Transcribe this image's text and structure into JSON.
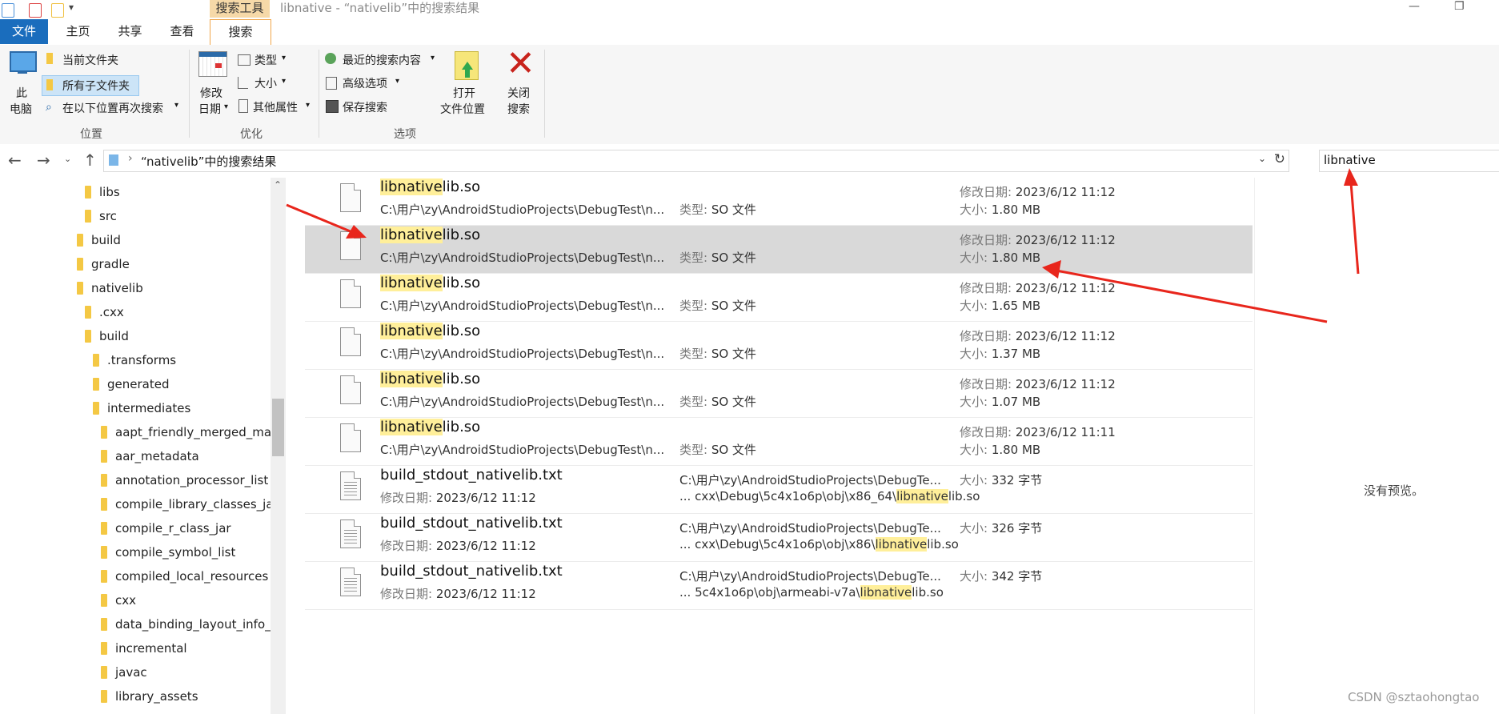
{
  "window": {
    "title": "libnative - “nativelib”中的搜索结果",
    "context_tab_header": "搜索工具"
  },
  "ribbon_tabs": [
    "文件",
    "主页",
    "共享",
    "查看",
    "搜索"
  ],
  "ribbon": {
    "this_pc_line1": "此",
    "this_pc_line2": "电脑",
    "current_folder": "当前文件夹",
    "all_subfolders": "所有子文件夹",
    "search_again_in": "在以下位置再次搜索",
    "group_location": "位置",
    "modified_line1": "修改",
    "modified_line2": "日期",
    "kind": "类型",
    "size": "大小",
    "other_properties": "其他属性",
    "group_refine": "优化",
    "recent_searches": "最近的搜索内容",
    "advanced_options": "高级选项",
    "save_search": "保存搜索",
    "open_location_line1": "打开",
    "open_location_line2": "文件位置",
    "close_search_line1": "关闭",
    "close_search_line2": "搜索",
    "group_options": "选项"
  },
  "address": {
    "path": "“nativelib”中的搜索结果",
    "search_value": "libnative"
  },
  "nav_tree": [
    {
      "label": "libs"
    },
    {
      "label": "src"
    },
    {
      "label": "build"
    },
    {
      "label": "gradle"
    },
    {
      "label": "nativelib"
    },
    {
      "label": ".cxx"
    },
    {
      "label": "build"
    },
    {
      "label": ".transforms"
    },
    {
      "label": "generated"
    },
    {
      "label": "intermediates"
    },
    {
      "label": "aapt_friendly_merged_ma"
    },
    {
      "label": "aar_metadata"
    },
    {
      "label": "annotation_processor_list"
    },
    {
      "label": "compile_library_classes_ja"
    },
    {
      "label": "compile_r_class_jar"
    },
    {
      "label": "compile_symbol_list"
    },
    {
      "label": "compiled_local_resources"
    },
    {
      "label": "cxx"
    },
    {
      "label": "data_binding_layout_info_"
    },
    {
      "label": "incremental"
    },
    {
      "label": "javac"
    },
    {
      "label": "library_assets"
    }
  ],
  "labels": {
    "modified": "修改日期: ",
    "size": "大小: ",
    "type": "类型: "
  },
  "results": [
    {
      "name_hl": "libnative",
      "name_rest": "lib.so",
      "path": "C:\\用户\\zy\\AndroidStudioProjects\\DebugTest\\n...",
      "type": "SO 文件",
      "date": "2023/6/12 11:12",
      "size": "1.80 MB"
    },
    {
      "name_hl": "libnative",
      "name_rest": "lib.so",
      "path": "C:\\用户\\zy\\AndroidStudioProjects\\DebugTest\\n...",
      "type": "SO 文件",
      "date": "2023/6/12 11:12",
      "size": "1.80 MB"
    },
    {
      "name_hl": "libnative",
      "name_rest": "lib.so",
      "path": "C:\\用户\\zy\\AndroidStudioProjects\\DebugTest\\n...",
      "type": "SO 文件",
      "date": "2023/6/12 11:12",
      "size": "1.65 MB"
    },
    {
      "name_hl": "libnative",
      "name_rest": "lib.so",
      "path": "C:\\用户\\zy\\AndroidStudioProjects\\DebugTest\\n...",
      "type": "SO 文件",
      "date": "2023/6/12 11:12",
      "size": "1.37 MB"
    },
    {
      "name_hl": "libnative",
      "name_rest": "lib.so",
      "path": "C:\\用户\\zy\\AndroidStudioProjects\\DebugTest\\n...",
      "type": "SO 文件",
      "date": "2023/6/12 11:12",
      "size": "1.07 MB"
    },
    {
      "name_hl": "libnative",
      "name_rest": "lib.so",
      "path": "C:\\用户\\zy\\AndroidStudioProjects\\DebugTest\\n...",
      "type": "SO 文件",
      "date": "2023/6/12 11:11",
      "size": "1.80 MB"
    }
  ],
  "text_results": [
    {
      "name": "build_stdout_nativelib.txt",
      "date": "2023/6/12 11:12",
      "path1": "C:\\用户\\zy\\AndroidStudioProjects\\DebugTe...",
      "snippet_pre": "... cxx\\Debug\\5c4x1o6p\\obj\\x86_64\\",
      "snippet_hl": "libnative",
      "snippet_post": "lib.so",
      "size": "332 字节"
    },
    {
      "name": "build_stdout_nativelib.txt",
      "date": "2023/6/12 11:12",
      "path1": "C:\\用户\\zy\\AndroidStudioProjects\\DebugTe...",
      "snippet_pre": "... cxx\\Debug\\5c4x1o6p\\obj\\x86\\",
      "snippet_hl": "libnative",
      "snippet_post": "lib.so",
      "size": "326 字节"
    },
    {
      "name": "build_stdout_nativelib.txt",
      "date": "2023/6/12 11:12",
      "path1": "C:\\用户\\zy\\AndroidStudioProjects\\DebugTe...",
      "snippet_pre": "... 5c4x1o6p\\obj\\armeabi-v7a\\",
      "snippet_hl": "libnative",
      "snippet_post": "lib.so",
      "size": "342 字节"
    }
  ],
  "preview": {
    "text": "没有预览。"
  },
  "watermark": "CSDN @sztaohongtao",
  "colors": {
    "accent_file_tab": "#1a6dbd",
    "highlight": "#ffef9a",
    "annotation_arrow": "#e8261c",
    "folder": "#f4c844"
  }
}
